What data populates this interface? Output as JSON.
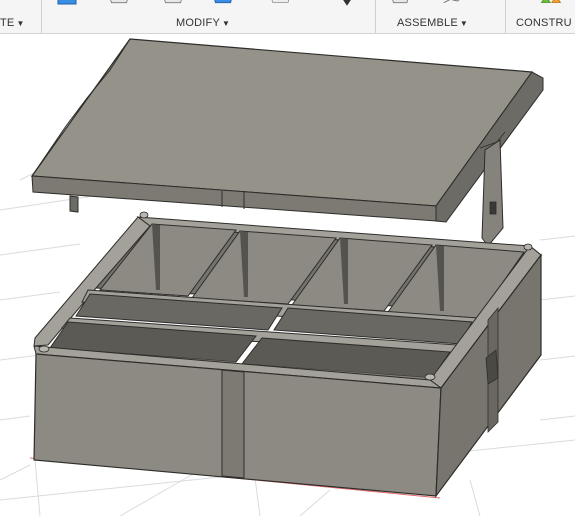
{
  "toolbar": {
    "groups": [
      {
        "label": "TE",
        "has_dropdown": true
      },
      {
        "label": "MODIFY",
        "has_dropdown": true
      },
      {
        "label": "ASSEMBLE",
        "has_dropdown": true
      },
      {
        "label": "CONSTRU",
        "has_dropdown": false
      }
    ],
    "caret": "▼",
    "icons": [
      "extrude-icon",
      "shell-icon",
      "fillet-icon",
      "press-pull-icon",
      "move-icon",
      "joint-icon",
      "plane-icon"
    ]
  },
  "viewport": {
    "model": "box-with-lid",
    "colors": {
      "body": "#8c8a82",
      "body_light": "#a3a199",
      "body_dark": "#5f5d57",
      "edge": "#2e2d2a",
      "grid": "#d9dbe0",
      "x_axis": "#e06a6a",
      "lid_top": "#959389"
    }
  }
}
